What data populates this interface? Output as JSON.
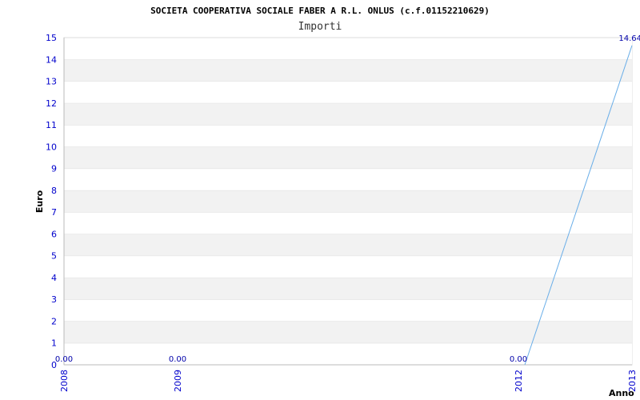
{
  "chart_data": {
    "type": "line",
    "title": "SOCIETA COOPERATIVA SOCIALE FABER A R.L. ONLUS (c.f.01152210629)",
    "subtitle": "Importi",
    "xlabel": "Anno",
    "ylabel": "Euro",
    "categories": [
      "2008",
      "2009",
      "2012",
      "2013"
    ],
    "series": [
      {
        "values": [
          0,
          0,
          0,
          14.64
        ],
        "labels": [
          "0.00",
          "0.00",
          "0.00",
          "14.64"
        ]
      }
    ],
    "ylim": [
      0,
      15
    ],
    "yticks": [
      "0",
      "1",
      "2",
      "3",
      "4",
      "5",
      "6",
      "7",
      "8",
      "9",
      "10",
      "11",
      "12",
      "13",
      "14",
      "15"
    ],
    "grid": "horizontal alternating bands",
    "colors": {
      "line": "#6aaee8",
      "band": "#f2f2f2",
      "gridline": "#dddddd",
      "tick_text": "#0000cc",
      "label_text": "#0000aa"
    }
  }
}
